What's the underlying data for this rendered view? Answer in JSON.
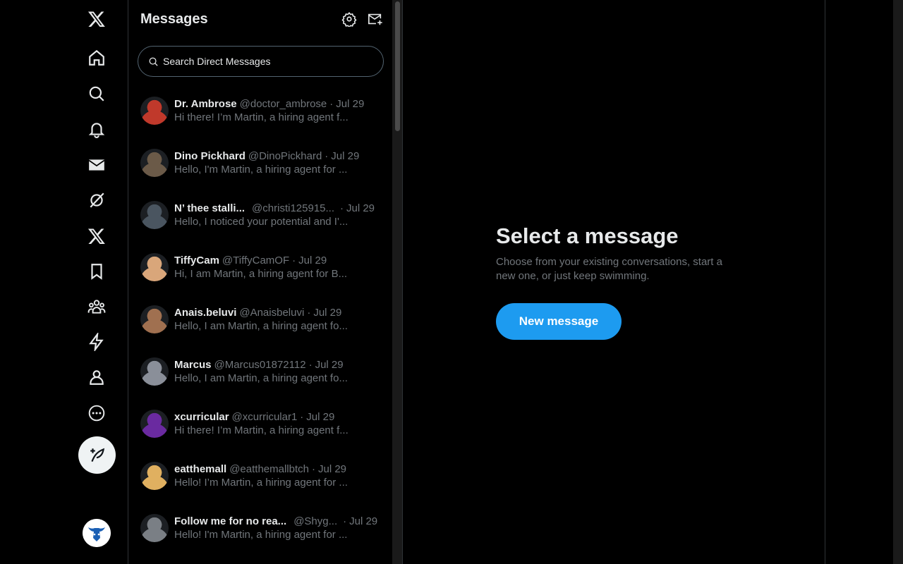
{
  "nav": {
    "items": [
      {
        "name": "x-logo-icon"
      },
      {
        "name": "home-icon"
      },
      {
        "name": "explore-icon"
      },
      {
        "name": "notifications-icon"
      },
      {
        "name": "messages-icon"
      },
      {
        "name": "grok-icon"
      },
      {
        "name": "premium-icon"
      },
      {
        "name": "bookmarks-icon"
      },
      {
        "name": "communities-icon"
      },
      {
        "name": "verified-orgs-icon"
      },
      {
        "name": "profile-icon"
      },
      {
        "name": "more-icon"
      }
    ],
    "post_button_icon": "compose-post-icon",
    "account_avatar": "account-avatar"
  },
  "messages": {
    "title": "Messages",
    "search_placeholder": "Search Direct Messages",
    "conversations": [
      {
        "name": "Dr. Ambrose",
        "handle": "@doctor_ambrose",
        "date": "Jul 29",
        "preview": "Hi there! I’m Martin, a hiring agent f...",
        "color": "#c0392b"
      },
      {
        "name": "Dino Pickhard",
        "handle": "@DinoPickhard",
        "date": "Jul 29",
        "preview": "Hello, I'm Martin, a hiring agent for ...",
        "color": "#6b5a48"
      },
      {
        "name": "N’ thee stalli...",
        "handle": "@christi125915...",
        "date": "Jul 29",
        "preview": "Hello, I noticed your potential and I'...",
        "color": "#4a5560"
      },
      {
        "name": "TiffyCam",
        "handle": "@TiffyCamOF",
        "date": "Jul 29",
        "preview": "Hi, I am Martin, a hiring agent for B...",
        "color": "#d9a67a"
      },
      {
        "name": "Anais.beluvi",
        "handle": "@Anaisbeluvi",
        "date": "Jul 29",
        "preview": "Hello, I am Martin, a hiring agent fo...",
        "color": "#a07050"
      },
      {
        "name": "Marcus",
        "handle": "@Marcus01872112",
        "date": "Jul 29",
        "preview": "Hello, I am Martin, a hiring agent fo...",
        "color": "#8a8f99"
      },
      {
        "name": "xcurricular",
        "handle": "@xcurricular1",
        "date": "Jul 29",
        "preview": "Hi there! I’m Martin, a hiring agent f...",
        "color": "#6a2aa0"
      },
      {
        "name": "eatthemall",
        "handle": "@eatthemallbtch",
        "date": "Jul 29",
        "preview": "Hello! I’m Martin, a hiring agent for ...",
        "color": "#e0b060"
      },
      {
        "name": "Follow me for no rea...",
        "handle": "@Shyg...",
        "date": "Jul 29",
        "preview": "Hello! I'm Martin, a hiring agent for ...",
        "color": "#7a7f85"
      }
    ]
  },
  "main": {
    "title": "Select a message",
    "subtitle": "Choose from your existing conversations, start a new one, or just keep swimming.",
    "new_message_label": "New message"
  },
  "colors": {
    "accent": "#1d9bf0",
    "background": "#000000",
    "text_primary": "#e7e9ea",
    "text_secondary": "#71767b",
    "border": "#2f3336"
  }
}
